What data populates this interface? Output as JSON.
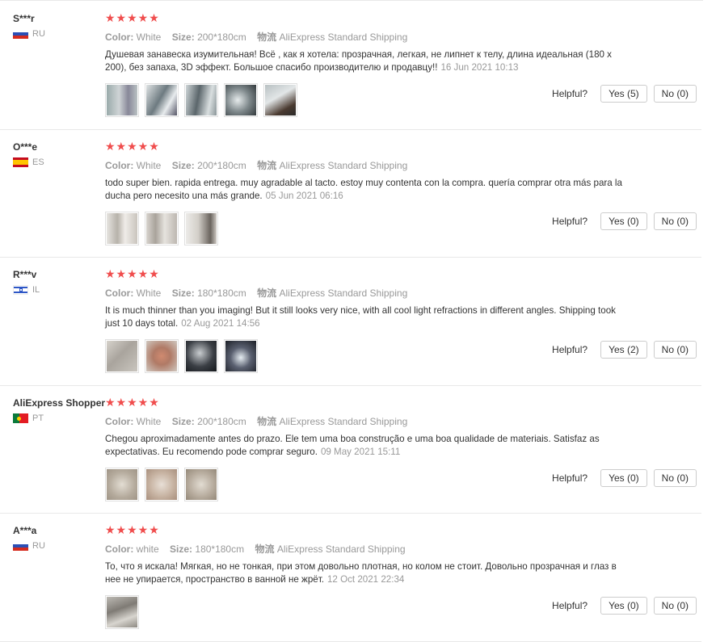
{
  "labels": {
    "color": "Color:",
    "size": "Size:",
    "shipping": "物流",
    "helpful": "Helpful?"
  },
  "stars_icon": "★★★★★",
  "reviews": [
    {
      "user": "S***r",
      "country": "RU",
      "flag": "russia",
      "color": "White",
      "size": "200*180cm",
      "shipping": "AliExpress Standard Shipping",
      "text": "Душевая занавеска изумительная! Всё , как я хотела: прозрачная, легкая, не липнет к телу, длина идеальная (180 х 200), без запаха, 3D эффект. Большое спасибо производителю и продавцу!!",
      "date": "16 Jun 2021 10:13",
      "yes": "Yes (5)",
      "no": "No (0)",
      "rating": 5
    },
    {
      "user": "O***e",
      "country": "ES",
      "flag": "spain",
      "color": "White",
      "size": "200*180cm",
      "shipping": "AliExpress Standard Shipping",
      "text": "todo super bien. rapida entrega. muy agradable al tacto. estoy muy contenta con la compra. quería comprar otra más para la ducha pero necesito una más grande.",
      "date": "05 Jun 2021 06:16",
      "yes": "Yes (0)",
      "no": "No (0)",
      "rating": 4.5
    },
    {
      "user": "R***v",
      "country": "IL",
      "flag": "israel",
      "color": "White",
      "size": "180*180cm",
      "shipping": "AliExpress Standard Shipping",
      "text": "It is much thinner than you imaging! But it still looks very nice, with all cool light refractions in different angles. Shipping took just 10 days total.",
      "date": "02 Aug 2021 14:56",
      "yes": "Yes (2)",
      "no": "No (0)",
      "rating": 5
    },
    {
      "user": "AliExpress Shopper",
      "country": "PT",
      "flag": "portugal",
      "color": "White",
      "size": "200*180cm",
      "shipping": "AliExpress Standard Shipping",
      "text": "Chegou aproximadamente antes do prazo. Ele tem uma boa construção e uma boa qualidade de materiais. Satisfaz as expectativas. Eu recomendo pode comprar seguro.",
      "date": "09 May 2021 15:11",
      "yes": "Yes (0)",
      "no": "No (0)",
      "rating": 4.5
    },
    {
      "user": "A***a",
      "country": "RU",
      "flag": "russia",
      "color": "white",
      "size": "180*180cm",
      "shipping": "AliExpress Standard Shipping",
      "text": "То, что я искала! Мягкая, но не тонкая, при этом довольно плотная, но колом не стоит. Довольно прозрачная и глаз в нее не упирается, пространство в ванной не жрёт.",
      "date": "12 Oct 2021 22:34",
      "yes": "Yes (0)",
      "no": "No (0)",
      "rating": 5
    }
  ]
}
